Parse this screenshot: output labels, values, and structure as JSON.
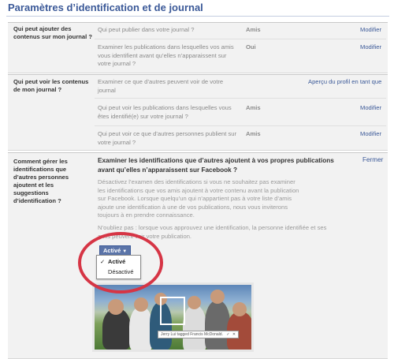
{
  "header": {
    "title": "Paramètres d’identification et de journal"
  },
  "sections": [
    {
      "label": "Qui peut ajouter des contenus sur mon journal ?",
      "rows": [
        {
          "question": "Qui peut publier dans votre journal ?",
          "value": "Amis",
          "action": "Modifier"
        },
        {
          "question": "Examiner les publications dans lesquelles vos amis vous identifient avant qu’elles n’apparaissent sur votre journal ?",
          "value": "Oui",
          "action": "Modifier"
        }
      ]
    },
    {
      "label": "Qui peut voir les contenus de mon journal ?",
      "rows": [
        {
          "question": "Examiner ce que d’autres peuvent voir de votre journal",
          "value": "",
          "action": "Aperçu du profil en tant que"
        },
        {
          "question": "Qui peut voir les publications dans lesquelles vous êtes identifié(e) sur votre journal ?",
          "value": "Amis",
          "action": "Modifier"
        },
        {
          "question": "Qui peut voir ce que d’autres personnes publient sur votre journal ?",
          "value": "Amis",
          "action": "Modifier"
        }
      ]
    },
    {
      "label": "Comment gérer les identifications que d’autres personnes ajoutent et les suggestions d’identification ?",
      "expanded": {
        "question": "Examiner les identifications que d’autres ajoutent à vos propres publications avant qu’elles n’apparaissent sur Facebook ?",
        "close": "Fermer",
        "description": "Désactivez l’examen des identifications si vous ne souhaitez pas examiner les identifications que vos amis ajoutent à votre contenu avant la publication sur Facebook. Lorsque quelqu’un qui n’appartient pas à votre liste d’amis ajoute une identification à une de vos publications, nous vous inviterons toujours à en prendre connaissance.",
        "note": "N’oubliez pas : lorsque vous approuvez une identification, la personne identifiée et ses amis peuvent voir votre publication.",
        "dropdown": {
          "selected": "Activé",
          "options": [
            "Activé",
            "Désactivé"
          ]
        },
        "photo_tag": {
          "text": "Jerry Lui tagged Francis McDonald.",
          "check": "✓",
          "close": "✕"
        }
      }
    }
  ],
  "colors": {
    "title": "#3b5998",
    "link": "#3b5998",
    "dropdown": "#5b74a8",
    "highlight_ring": "#d63545"
  }
}
